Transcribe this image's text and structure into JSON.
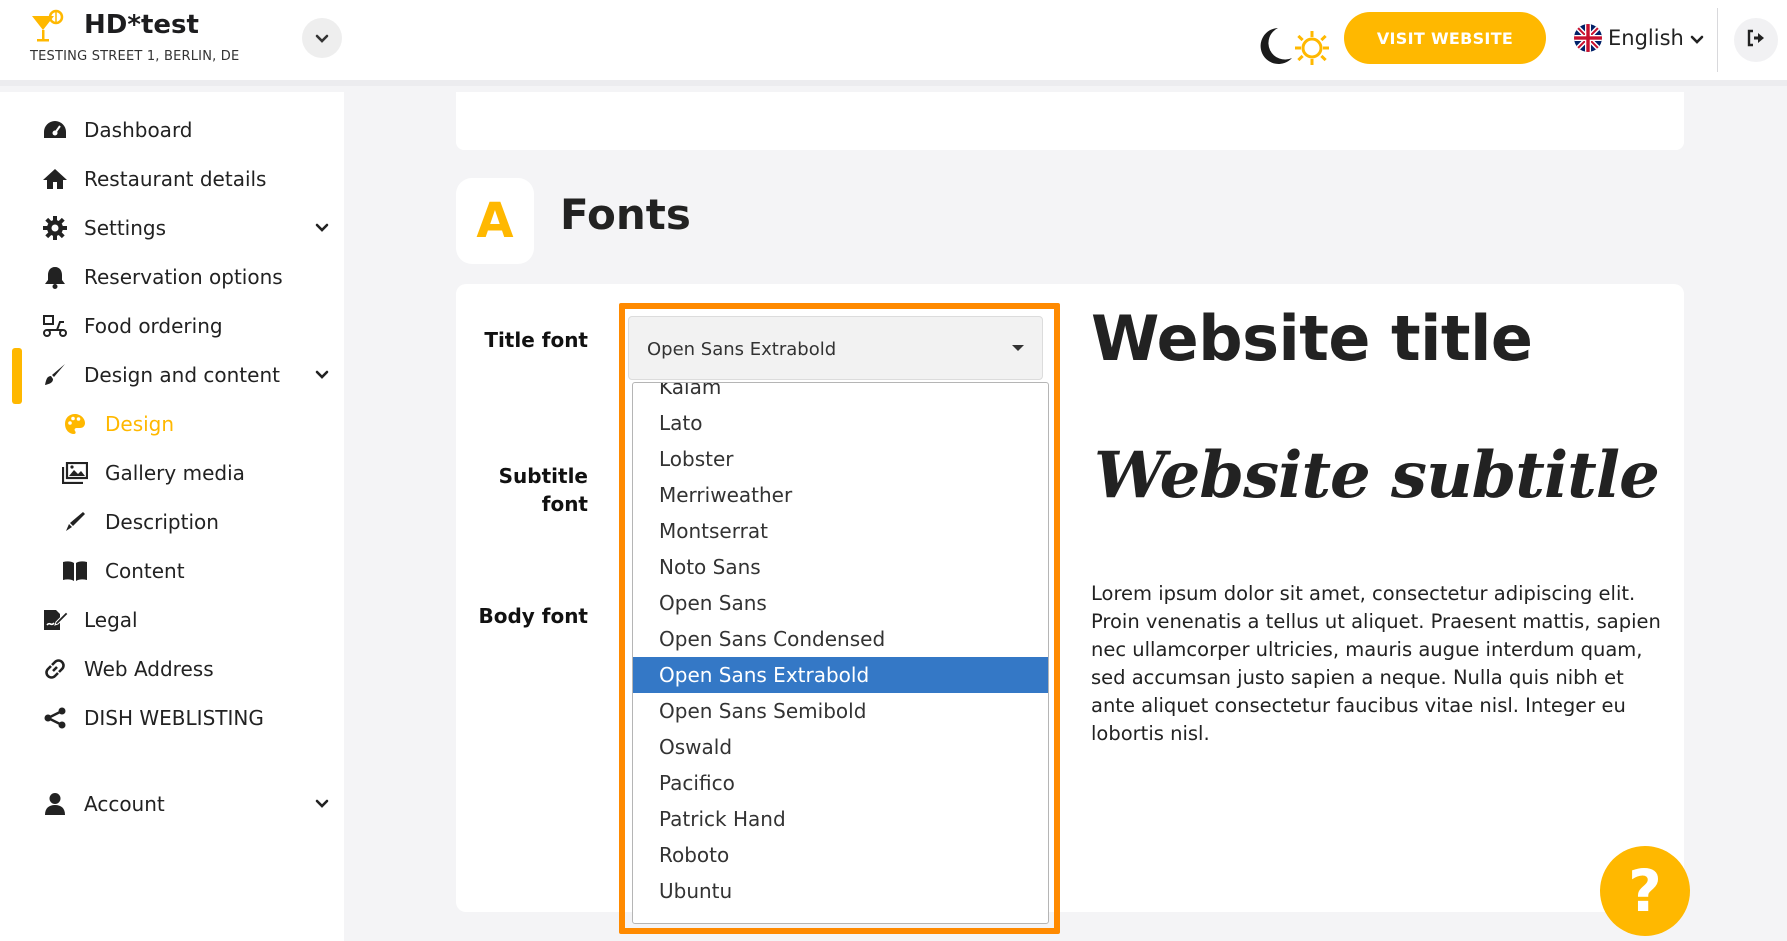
{
  "brand": {
    "name": "HD*test",
    "address": "TESTING STREET 1, BERLIN, DE"
  },
  "header": {
    "visit_label": "VISIT WEBSITE",
    "language": "English"
  },
  "sidebar": {
    "items": [
      {
        "label": "Dashboard",
        "icon": "dashboard-icon"
      },
      {
        "label": "Restaurant details",
        "icon": "home-icon"
      },
      {
        "label": "Settings",
        "icon": "gear-icon"
      },
      {
        "label": "Reservation options",
        "icon": "bell-icon"
      },
      {
        "label": "Food ordering",
        "icon": "scooter-icon"
      },
      {
        "label": "Design and content",
        "icon": "brush-icon"
      },
      {
        "label": "Design",
        "icon": "palette-icon"
      },
      {
        "label": "Gallery media",
        "icon": "images-icon"
      },
      {
        "label": "Description",
        "icon": "pen-icon"
      },
      {
        "label": "Content",
        "icon": "book-icon"
      },
      {
        "label": "Legal",
        "icon": "signature-icon"
      },
      {
        "label": "Web Address",
        "icon": "link-icon"
      },
      {
        "label": "DISH WEBLISTING",
        "icon": "share-icon"
      },
      {
        "label": "Account",
        "icon": "user-icon"
      }
    ]
  },
  "fonts": {
    "icon_letter": "A",
    "heading": "Fonts",
    "title_label": "Title font",
    "subtitle_label_line1": "Subtitle",
    "subtitle_label_line2": "font",
    "body_label": "Body font",
    "selected_title_font": "Open Sans Extrabold",
    "options": [
      "Kalam",
      "Lato",
      "Lobster",
      "Merriweather",
      "Montserrat",
      "Noto Sans",
      "Open Sans",
      "Open Sans Condensed",
      "Open Sans Extrabold",
      "Open Sans Semibold",
      "Oswald",
      "Pacifico",
      "Patrick Hand",
      "Roboto",
      "Ubuntu"
    ]
  },
  "preview": {
    "title": "Website title",
    "subtitle": "Website subtitle",
    "body": "Lorem ipsum dolor sit amet, consectetur adipiscing elit. Proin venenatis a tellus ut aliquet. Praesent mattis, sapien nec ullamcorper ultricies, mauris augue interdum quam, sed accumsan justo sapien a neque. Nulla quis nibh et ante aliquet consectetur faucibus vitae nisl. Integer eu lobortis nisl."
  },
  "help": {
    "label": "?"
  },
  "colors": {
    "accent": "#ffb800",
    "highlight": "#ff8a00",
    "selected_option": "#3478c6"
  }
}
